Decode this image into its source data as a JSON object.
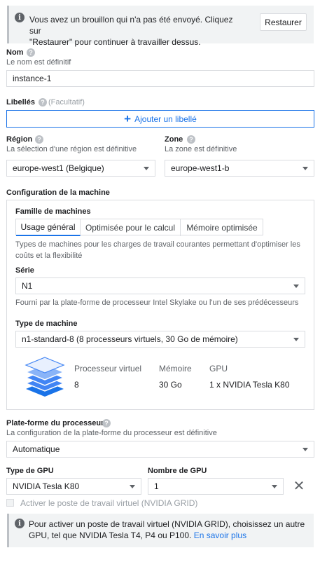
{
  "banner": {
    "message": "Vous avez un brouillon qui n'a pas été envoyé. Cliquez sur \"Restaurer\" pour continuer à travailler dessus.",
    "line1": "Vous avez un brouillon qui n'a pas été envoyé. Cliquez sur",
    "line2": "\"Restaurer\" pour continuer à travailler dessus.",
    "restore_label": "Restaurer"
  },
  "name": {
    "label": "Nom",
    "hint": "Le nom est définitif",
    "value": "instance-1"
  },
  "labels": {
    "label": "Libellés",
    "optional": "(Facultatif)",
    "add_label": "Ajouter un libellé"
  },
  "region": {
    "label": "Région",
    "hint": "La sélection d'une région est définitive",
    "value": "europe-west1 (Belgique)"
  },
  "zone": {
    "label": "Zone",
    "hint": "La zone est définitive",
    "value": "europe-west1-b"
  },
  "machine_config": {
    "title": "Configuration de la machine",
    "family_label": "Famille de machines",
    "tabs": [
      "Usage général",
      "Optimisée pour le calcul",
      "Mémoire optimisée"
    ],
    "family_desc_line1": "Types de machines pour les charges de travail courantes permettant d'optimiser les",
    "family_desc_line2": "coûts et la flexibilité",
    "series_label": "Série",
    "series_value": "N1",
    "series_desc": "Fourni par la plate-forme de processeur Intel Skylake ou l'un de ses prédécesseurs",
    "type_label": "Type de machine",
    "type_value": "n1-standard-8 (8 processeurs virtuels, 30 Go de mémoire)",
    "specs": {
      "cpu_header": "Processeur virtuel",
      "cpu_value": "8",
      "mem_header": "Mémoire",
      "mem_value": "30 Go",
      "gpu_header": "GPU",
      "gpu_value": "1 x NVIDIA Tesla K80"
    }
  },
  "cpu_platform": {
    "label": "Plate-forme du processeur",
    "hint": "La configuration de la plate-forme du processeur est définitive",
    "value": "Automatique"
  },
  "gpu": {
    "type_label": "Type de GPU",
    "type_value": "NVIDIA Tesla K80",
    "count_label": "Nombre de GPU",
    "count_value": "1",
    "virtual_ws_label": "Activer le poste de travail virtuel (NVIDIA GRID)",
    "info_line1": "Pour activer un poste de travail virtuel (NVIDIA GRID), choisissez un autre",
    "info_line2": "GPU, tel que NVIDIA Tesla T4, P4 ou P100.",
    "learn_more": "En savoir plus"
  },
  "colors": {
    "accent": "#1a73e8",
    "border": "#dadce0",
    "banner_bg": "#f1f3f4",
    "text": "#202124",
    "hint": "#5f6368"
  }
}
